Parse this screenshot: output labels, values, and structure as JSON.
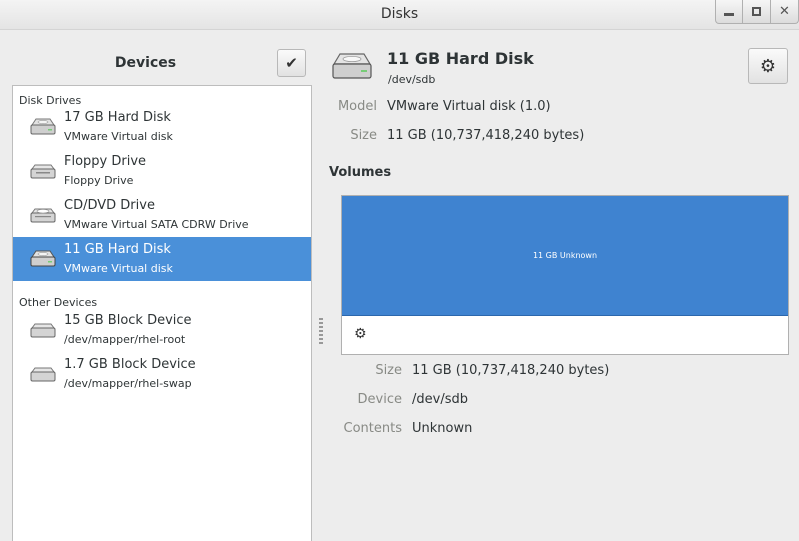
{
  "window": {
    "title": "Disks"
  },
  "sidebar": {
    "title": "Devices",
    "sections": [
      {
        "header": "Disk Drives",
        "items": [
          {
            "name": "17 GB Hard Disk",
            "sub": "VMware Virtual disk",
            "icon": "hard-disk-icon",
            "selected": false
          },
          {
            "name": "Floppy Drive",
            "sub": "Floppy Drive",
            "icon": "floppy-drive-icon",
            "selected": false
          },
          {
            "name": "CD/DVD Drive",
            "sub": "VMware Virtual SATA CDRW Drive",
            "icon": "optical-drive-icon",
            "selected": false
          },
          {
            "name": "11 GB Hard Disk",
            "sub": "VMware Virtual disk",
            "icon": "hard-disk-icon",
            "selected": true
          }
        ]
      },
      {
        "header": "Other Devices",
        "items": [
          {
            "name": "15 GB Block Device",
            "sub": "/dev/mapper/rhel-root",
            "icon": "block-device-icon",
            "selected": false
          },
          {
            "name": "1.7 GB Block Device",
            "sub": "/dev/mapper/rhel-swap",
            "icon": "block-device-icon",
            "selected": false
          }
        ]
      }
    ]
  },
  "disk": {
    "title": "11 GB Hard Disk",
    "path": "/dev/sdb",
    "model_label": "Model",
    "model_value": "VMware Virtual disk (1.0)",
    "size_label": "Size",
    "size_value": "11 GB (10,737,418,240 bytes)"
  },
  "volumes": {
    "header": "Volumes",
    "bar_label": "11 GB Unknown",
    "bar_color": "#3f83d0",
    "size_label": "Size",
    "size_value": "11 GB (10,737,418,240 bytes)",
    "device_label": "Device",
    "device_value": "/dev/sdb",
    "contents_label": "Contents",
    "contents_value": "Unknown"
  },
  "colors": {
    "selection": "#4a90d9",
    "background": "#ededed"
  }
}
